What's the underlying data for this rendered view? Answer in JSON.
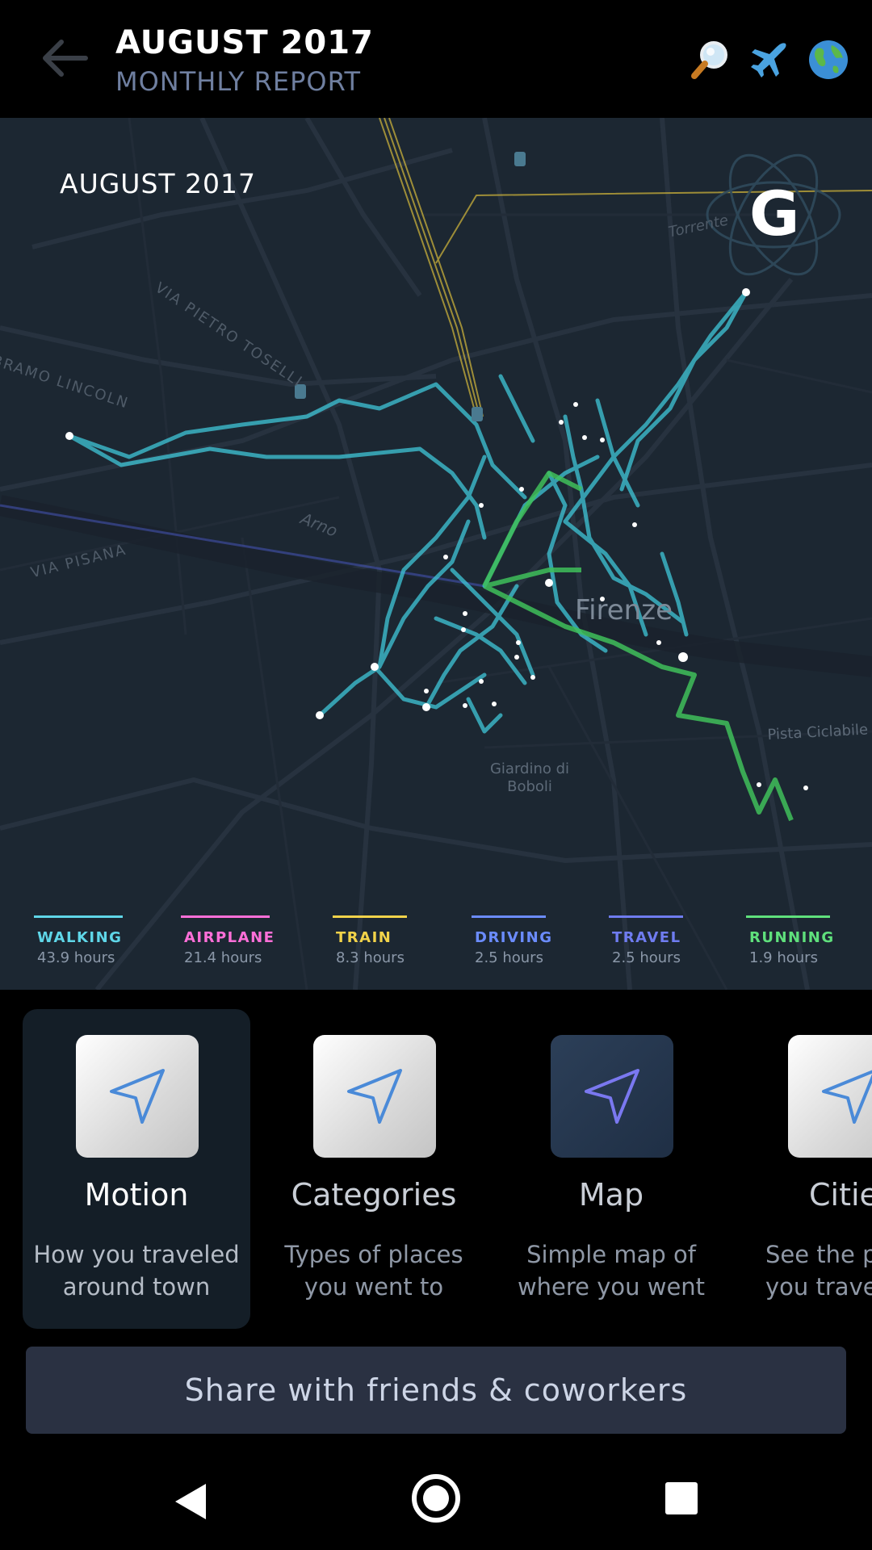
{
  "header": {
    "title": "AUGUST 2017",
    "subtitle": "MONTHLY REPORT",
    "icons": [
      "back-arrow-icon",
      "magnifier-icon",
      "airplane-icon",
      "globe-icon"
    ]
  },
  "map": {
    "title": "AUGUST 2017",
    "city_label": "Firenze",
    "place_labels": [
      "VIA PIETRO TOSELLI",
      "VIA PISANA",
      "BRAMO LINCOLN",
      "Arno",
      "Giardino di Boboli",
      "Pista Ciclabile",
      "Torrente"
    ],
    "logo_letter": "G",
    "legend": [
      {
        "name": "WALKING",
        "value": "43.9 hours",
        "color": "#5fd6e8"
      },
      {
        "name": "AIRPLANE",
        "value": "21.4 hours",
        "color": "#ff6fd8"
      },
      {
        "name": "TRAIN",
        "value": "8.3 hours",
        "color": "#f2d34a"
      },
      {
        "name": "DRIVING",
        "value": "2.5 hours",
        "color": "#6b8cff"
      },
      {
        "name": "TRAVEL",
        "value": "2.5 hours",
        "color": "#6f7cf0"
      },
      {
        "name": "RUNNING",
        "value": "1.9 hours",
        "color": "#5fe07c"
      }
    ]
  },
  "cards": [
    {
      "name": "Motion",
      "desc1": "How you traveled",
      "desc2": "around town",
      "icon": "navigation-arrow-icon"
    },
    {
      "name": "Categories",
      "desc1": "Types of places",
      "desc2": "you went to",
      "icon": "navigation-arrow-icon"
    },
    {
      "name": "Map",
      "desc1": "Simple map of",
      "desc2": "where you went",
      "icon": "navigation-arrow-icon"
    },
    {
      "name": "Citie",
      "desc1": "See the p",
      "desc2": "you trave",
      "icon": "navigation-arrow-icon"
    }
  ],
  "share_button": "Share with friends & coworkers",
  "navbar": {
    "icons": [
      "nav-back-icon",
      "nav-home-icon",
      "nav-recents-icon"
    ]
  },
  "colors": {
    "walking_route": "#3fc6d8",
    "running_route": "#3fbf5a",
    "train_route": "#c9b03a",
    "map_bg": "#1c2732"
  }
}
